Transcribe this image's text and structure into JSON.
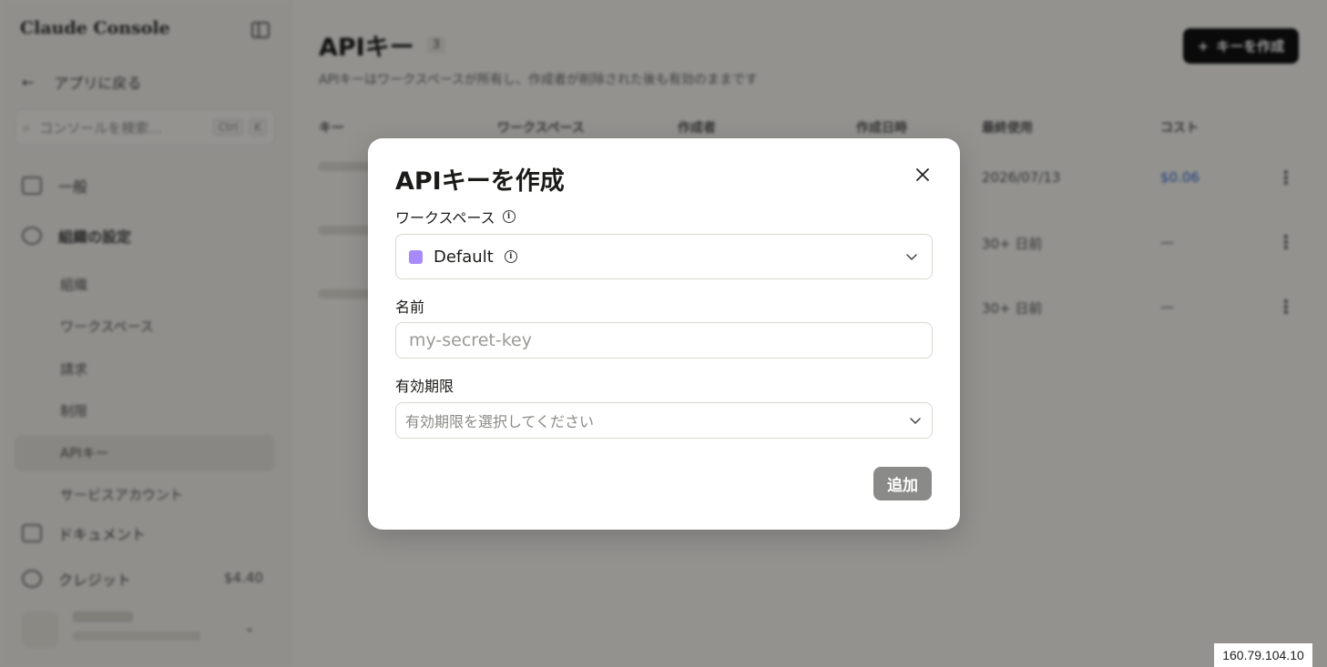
{
  "sidebar": {
    "brand": "Claude Console",
    "back_label": "アプリに戻る",
    "search_placeholder": "コンソールを検索...",
    "search_kbd": [
      "Ctrl",
      "K"
    ],
    "general": "一般",
    "org_settings": "組織の設定",
    "sub_items": [
      "組織",
      "ワークスペース",
      "請求",
      "制限",
      "APIキー",
      "サービスアカウント"
    ],
    "docs": "ドキュメント",
    "credits": "クレジット",
    "credits_value": "$4.40"
  },
  "main": {
    "title": "APIキー",
    "count": "3",
    "subtitle": "APIキーはワークスペースが所有し、作成者が削除された後も有効のままです",
    "create_button": "キーを作成",
    "headers": [
      "キー",
      "ワークスペース",
      "作成者",
      "作成日時",
      "最終使用",
      "コスト"
    ],
    "rows": [
      {
        "last_used": "2026/07/13",
        "cost": "$0.06"
      },
      {
        "last_used": "30+ 日前",
        "cost": "—"
      },
      {
        "last_used": "30+ 日前",
        "cost": "—"
      }
    ]
  },
  "modal": {
    "title": "APIキーを作成",
    "workspace_label": "ワークスペース",
    "workspace_value": "Default",
    "name_label": "名前",
    "name_placeholder": "my-secret-key",
    "expiry_label": "有効期限",
    "expiry_placeholder": "有効期限を選択してください",
    "add_button": "追加",
    "accent_color": "#a78bfa"
  },
  "ip_address": "160.79.104.10"
}
